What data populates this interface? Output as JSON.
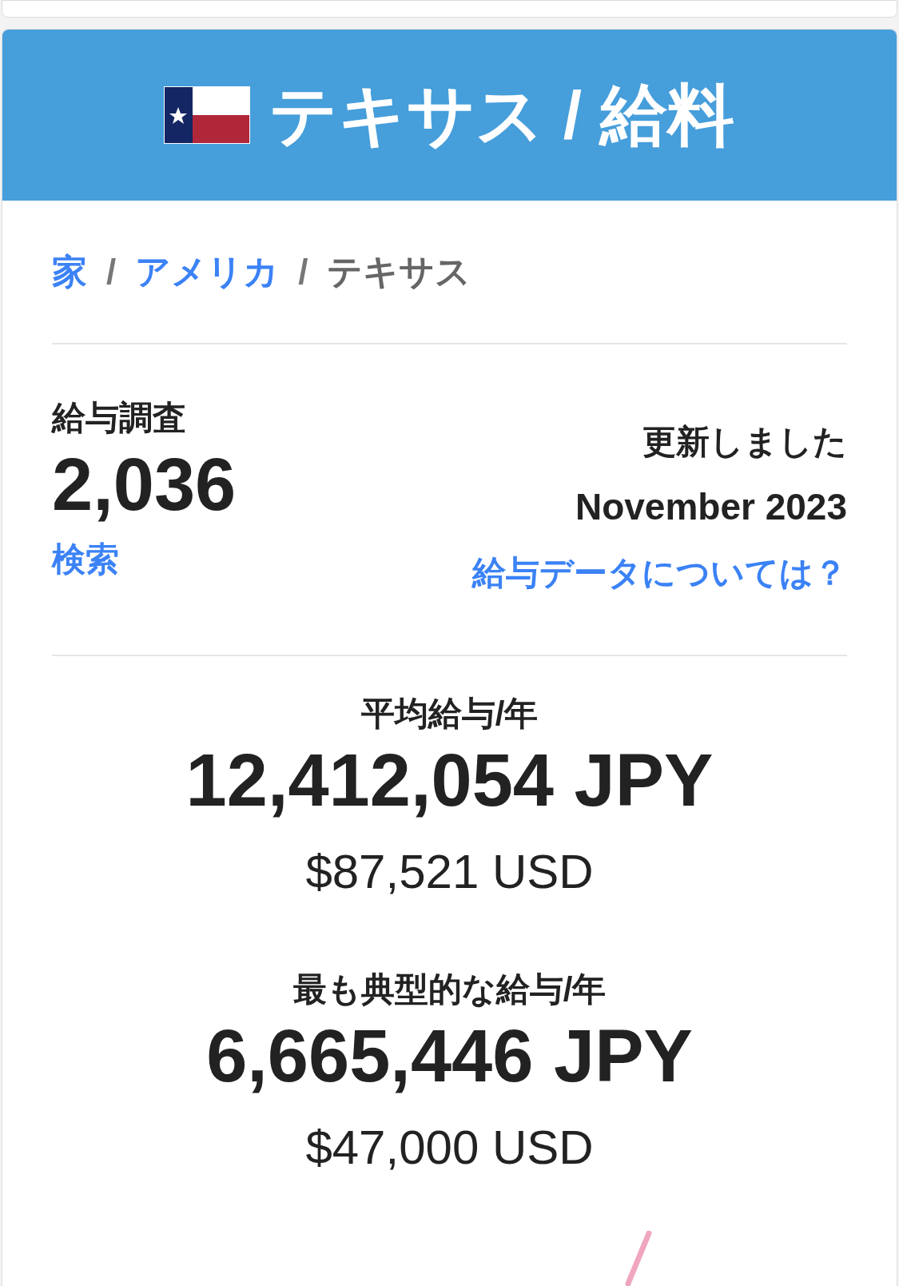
{
  "header": {
    "title": "テキサス / 給料"
  },
  "breadcrumbs": [
    {
      "label": "家",
      "link": true
    },
    {
      "label": "アメリカ",
      "link": true
    },
    {
      "label": "テキサス",
      "link": false
    }
  ],
  "breadcrumb_separator": "/",
  "surveys": {
    "label": "給与調査",
    "value": "2,036",
    "link": "検索"
  },
  "updated": {
    "label": "更新しました",
    "date": "November 2023",
    "link": "給与データについては？"
  },
  "salaries": [
    {
      "label": "平均給与/年",
      "jpy": "12,412,054 JPY",
      "usd": "$87,521 USD"
    },
    {
      "label": "最も典型的な給与/年",
      "jpy": "6,665,446 JPY",
      "usd": "$47,000 USD"
    }
  ]
}
